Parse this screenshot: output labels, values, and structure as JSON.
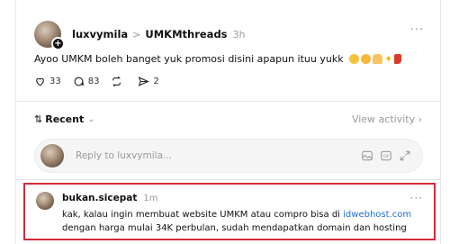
{
  "post": {
    "username": "luxvymila",
    "separator": ">",
    "group": "UMKMthreads",
    "time": "3h",
    "more": "···",
    "text": "Ayoo UMKM boleh banget yuk promosi disini apapun ituu yukk",
    "emojis": [
      "smiling-face",
      "hugging-face",
      "raised-hands",
      "sparkles",
      "dancer"
    ],
    "stats": {
      "likes": "33",
      "comments": "83",
      "reposts": "",
      "shares": "2"
    }
  },
  "sort": {
    "arrows": "⇅",
    "label": "Recent",
    "chevron": "⌄",
    "view_activity": "View activity ›"
  },
  "reply": {
    "placeholder": "Reply to luxvymila..."
  },
  "comment": {
    "username": "bukan.sicepat",
    "time": "1m",
    "more": "···",
    "text_before": "kak, kalau ingin membuat website UMKM atau compro bisa di ",
    "link": "idwebhost.com",
    "text_after": " dengan harga mulai 34K perbulan, sudah mendapatkan domain dan hosting",
    "highlight_color": "#d32a3a",
    "link_color": "#1f6fd6"
  }
}
